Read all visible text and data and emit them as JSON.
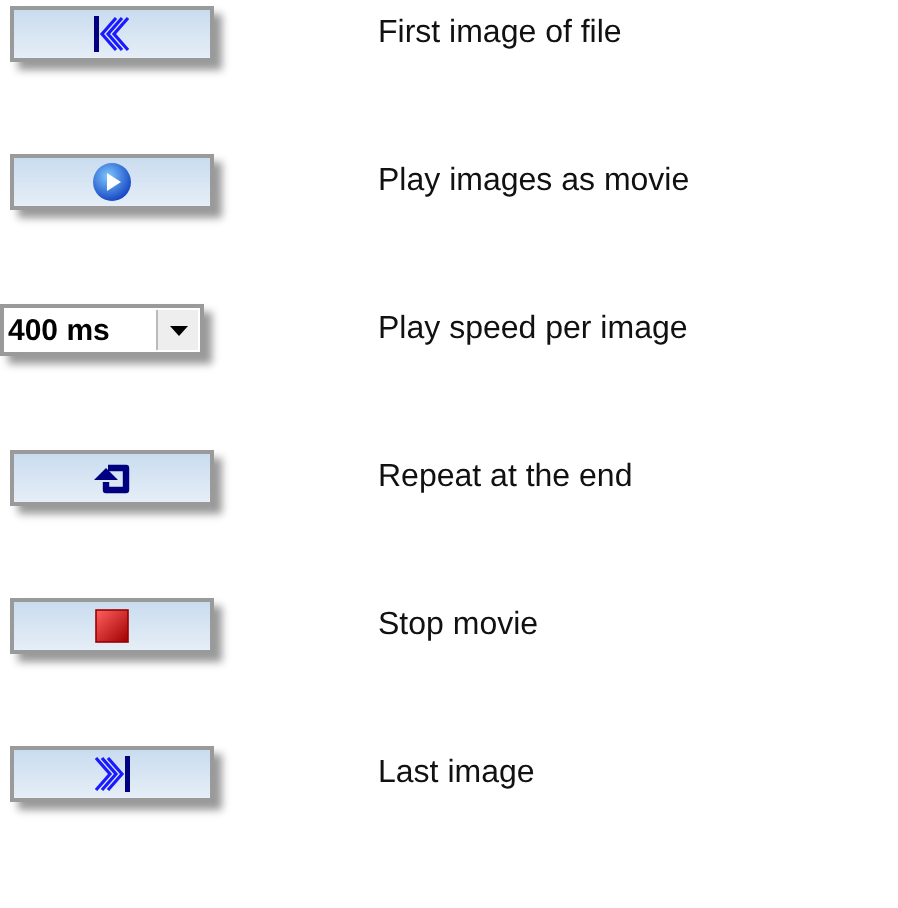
{
  "controls": [
    {
      "kind": "first",
      "description": "First image of file"
    },
    {
      "kind": "play",
      "description": "Play images as movie"
    },
    {
      "kind": "speed",
      "value": "400 ms",
      "description": "Play speed per image"
    },
    {
      "kind": "repeat",
      "description": "Repeat at the end"
    },
    {
      "kind": "stop",
      "description": "Stop movie"
    },
    {
      "kind": "last",
      "description": "Last image"
    }
  ]
}
